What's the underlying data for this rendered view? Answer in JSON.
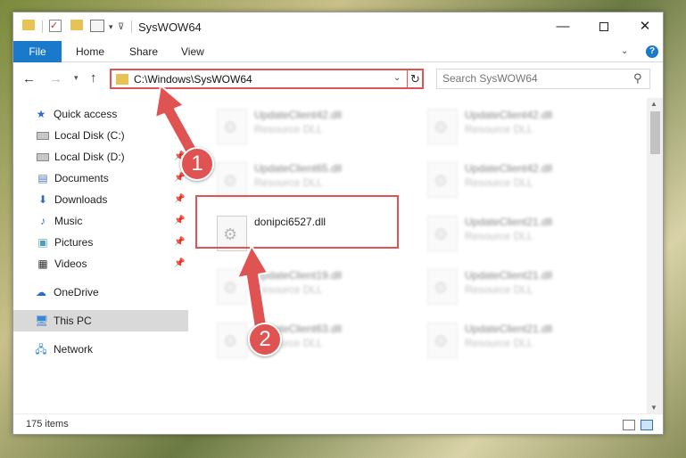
{
  "window": {
    "title": "SysWOW64"
  },
  "ribbon": {
    "file": "File",
    "home": "Home",
    "share": "Share",
    "view": "View"
  },
  "address": {
    "path": "C:\\Windows\\SysWOW64"
  },
  "search": {
    "placeholder": "Search SysWOW64"
  },
  "sidebar": {
    "quick_access": "Quick access",
    "items": [
      {
        "label": "Local Disk (C:)"
      },
      {
        "label": "Local Disk (D:)"
      },
      {
        "label": "Documents"
      },
      {
        "label": "Downloads"
      },
      {
        "label": "Music"
      },
      {
        "label": "Pictures"
      },
      {
        "label": "Videos"
      }
    ],
    "onedrive": "OneDrive",
    "this_pc": "This PC",
    "network": "Network"
  },
  "files": [
    {
      "name": "UpdateClient42.dll",
      "type": "Resource DLL"
    },
    {
      "name": "UpdateClient42.dll",
      "type": "Resource DLL"
    },
    {
      "name": "UpdateClient65.dll",
      "type": "Resource DLL"
    },
    {
      "name": "UpdateClient42.dll",
      "type": "Resource DLL"
    },
    {
      "name": "donipci6527.dll",
      "type": ""
    },
    {
      "name": "UpdateClient21.dll",
      "type": "Resource DLL"
    },
    {
      "name": "UpdateClient19.dll",
      "type": "Resource DLL"
    },
    {
      "name": "UpdateClient21.dll",
      "type": "Resource DLL"
    },
    {
      "name": "UpdateClient63.dll",
      "type": "Resource DLL"
    },
    {
      "name": "UpdateClient21.dll",
      "type": "Resource DLL"
    }
  ],
  "status": {
    "count": "175 items"
  },
  "annotations": {
    "step1": "1",
    "step2": "2",
    "color": "#e05353"
  }
}
